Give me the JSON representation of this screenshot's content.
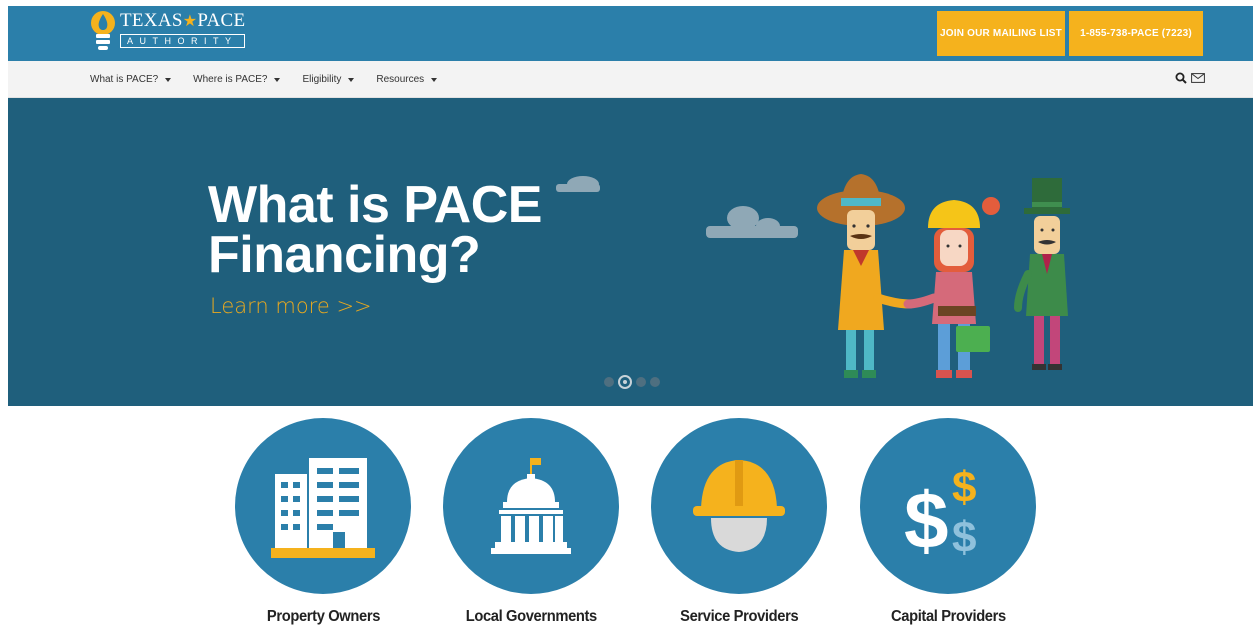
{
  "header": {
    "logo_title_left": "TEXAS",
    "logo_title_right": "PACE",
    "logo_star": "★",
    "logo_subtitle": "AUTHORITY",
    "mailing_button": "JOIN OUR MAILING LIST",
    "phone_button": "1-855-738-PACE (7223)"
  },
  "nav": {
    "items": [
      {
        "label": "What is PACE?"
      },
      {
        "label": "Where is PACE?"
      },
      {
        "label": "Eligibility"
      },
      {
        "label": "Resources"
      }
    ],
    "search_icon": "search-icon",
    "mail_icon": "envelope-icon"
  },
  "hero": {
    "headline": "What is PACE Financing?",
    "link": "Learn more >>",
    "slides": 4,
    "active_slide": 2
  },
  "audiences": [
    {
      "label": "Property Owners",
      "icon": "buildings-icon"
    },
    {
      "label": "Local Governments",
      "icon": "capitol-icon"
    },
    {
      "label": "Service Providers",
      "icon": "hard-hat-icon"
    },
    {
      "label": "Capital Providers",
      "icon": "dollar-signs-icon"
    }
  ],
  "colors": {
    "brand_blue": "#2b7faa",
    "hero_bg": "#1f5f7c",
    "accent_yellow": "#f5b21d",
    "link_gold": "#e9a91f"
  }
}
